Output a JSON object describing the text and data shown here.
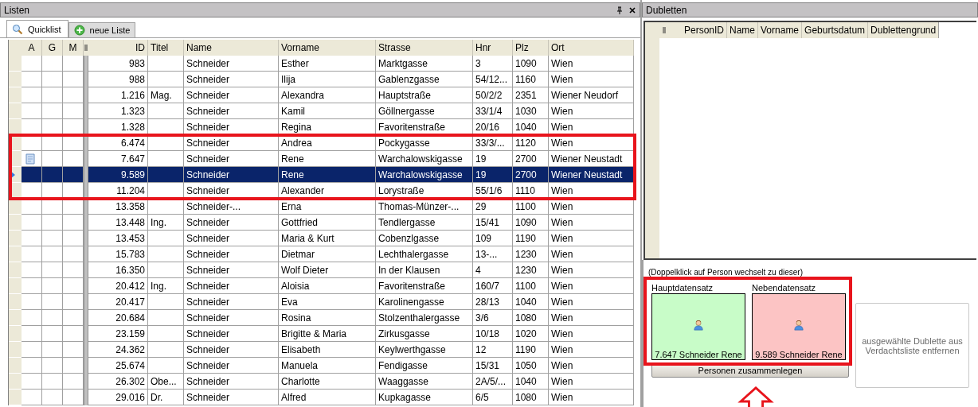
{
  "left_panel": {
    "title": "Listen",
    "tabs": [
      {
        "label": "Quicklist",
        "selected": true
      },
      {
        "label": "neue Liste",
        "selected": false
      }
    ],
    "table": {
      "columns": [
        "A",
        "G",
        "M",
        "ID",
        "Titel",
        "Name",
        "Vorname",
        "Strasse",
        "Hnr",
        "Plz",
        "Ort"
      ],
      "rows": [
        {
          "id": "983",
          "name": "Schneider",
          "vorname": "Esther",
          "strasse": "Marktgasse",
          "hnr": "3",
          "plz": "1090",
          "ort": "Wien",
          "note": false,
          "selected": false
        },
        {
          "id": "988",
          "name": "Schneider",
          "vorname": "Ilija",
          "strasse": "Gablenzgasse",
          "hnr": "54/12...",
          "plz": "1160",
          "ort": "Wien",
          "note": false,
          "selected": false
        },
        {
          "id": "1.216",
          "titel": "Mag.",
          "name": "Schneider",
          "vorname": "Alexandra",
          "strasse": "Hauptstraße",
          "hnr": "50/2/2",
          "plz": "2351",
          "ort": "Wiener Neudorf",
          "note": false,
          "selected": false
        },
        {
          "id": "1.323",
          "name": "Schneider",
          "vorname": "Kamil",
          "strasse": "Göllnergasse",
          "hnr": "33/1/4",
          "plz": "1030",
          "ort": "Wien",
          "note": false,
          "selected": false
        },
        {
          "id": "1.328",
          "name": "Schneider",
          "vorname": "Regina",
          "strasse": "Favoritenstraße",
          "hnr": "20/16",
          "plz": "1040",
          "ort": "Wien",
          "note": false,
          "selected": false
        },
        {
          "id": "6.474",
          "name": "Schneider",
          "vorname": "Andrea",
          "strasse": "Pockygasse",
          "hnr": "33/3/...",
          "plz": "1120",
          "ort": "Wien",
          "note": false,
          "selected": false
        },
        {
          "id": "7.647",
          "name": "Schneider",
          "vorname": "Rene",
          "strasse": "Warchalowskigasse",
          "hnr": "19",
          "plz": "2700",
          "ort": "Wiener Neustadt",
          "note": true,
          "selected": false
        },
        {
          "id": "9.589",
          "name": "Schneider",
          "vorname": "Rene",
          "strasse": "Warchalowskigasse",
          "hnr": "19",
          "plz": "2700",
          "ort": "Wiener Neustadt",
          "note": false,
          "selected": true
        },
        {
          "id": "11.204",
          "name": "Schneider",
          "vorname": "Alexander",
          "strasse": "Lorystraße",
          "hnr": "55/1/6",
          "plz": "1110",
          "ort": "Wien",
          "note": false,
          "selected": false
        },
        {
          "id": "13.358",
          "name": "Schneider-...",
          "vorname": "Erna",
          "strasse": "Thomas-Münzer-...",
          "hnr": "29",
          "plz": "1100",
          "ort": "Wien",
          "note": false,
          "selected": false
        },
        {
          "id": "13.448",
          "titel": "Ing.",
          "name": "Schneider",
          "vorname": "Gottfried",
          "strasse": "Tendlergasse",
          "hnr": "15/41",
          "plz": "1090",
          "ort": "Wien",
          "note": false,
          "selected": false
        },
        {
          "id": "13.453",
          "name": "Schneider",
          "vorname": "Maria & Kurt",
          "strasse": "Cobenzlgasse",
          "hnr": "109",
          "plz": "1190",
          "ort": "Wien",
          "note": false,
          "selected": false
        },
        {
          "id": "15.783",
          "name": "Schneider",
          "vorname": "Dietmar",
          "strasse": "Lechthalergasse",
          "hnr": "13-...",
          "plz": "1230",
          "ort": "Wien",
          "note": false,
          "selected": false
        },
        {
          "id": "16.350",
          "name": "Schneider",
          "vorname": "Wolf Dieter",
          "strasse": "In der Klausen",
          "hnr": "4",
          "plz": "1230",
          "ort": "Wien",
          "note": false,
          "selected": false
        },
        {
          "id": "20.412",
          "titel": "Ing.",
          "name": "Schneider",
          "vorname": "Aloisia",
          "strasse": "Favoritenstraße",
          "hnr": "160/7",
          "plz": "1100",
          "ort": "Wien",
          "note": false,
          "selected": false
        },
        {
          "id": "20.417",
          "name": "Schneider",
          "vorname": "Eva",
          "strasse": "Karolinengasse",
          "hnr": "28/13",
          "plz": "1040",
          "ort": "Wien",
          "note": false,
          "selected": false
        },
        {
          "id": "20.684",
          "name": "Schneider",
          "vorname": "Rosina",
          "strasse": "Stolzenthalergasse",
          "hnr": "3/6",
          "plz": "1080",
          "ort": "Wien",
          "note": false,
          "selected": false
        },
        {
          "id": "23.159",
          "name": "Schneider",
          "vorname": "Brigitte & Maria",
          "strasse": "Zirkusgasse",
          "hnr": "10/18",
          "plz": "1020",
          "ort": "Wien",
          "note": false,
          "selected": false
        },
        {
          "id": "24.362",
          "name": "Schneider",
          "vorname": "Elisabeth",
          "strasse": "Keylwerthgasse",
          "hnr": "12",
          "plz": "1190",
          "ort": "Wien",
          "note": false,
          "selected": false
        },
        {
          "id": "25.674",
          "name": "Schneider",
          "vorname": "Manuela",
          "strasse": "Fendigasse",
          "hnr": "15/31",
          "plz": "1050",
          "ort": "Wien",
          "note": false,
          "selected": false
        },
        {
          "id": "26.302",
          "titel": "Obe...",
          "name": "Schneider",
          "vorname": "Charlotte",
          "strasse": "Waaggasse",
          "hnr": "2A/5/...",
          "plz": "1040",
          "ort": "Wien",
          "note": false,
          "selected": false
        },
        {
          "id": "29.016",
          "titel": "Dr.",
          "name": "Schneider",
          "vorname": "Alfred",
          "strasse": "Kupkagasse",
          "hnr": "6/5",
          "plz": "1080",
          "ort": "Wien",
          "note": false,
          "selected": false
        }
      ]
    }
  },
  "right_panel": {
    "title": "Dubletten",
    "columns": [
      "PersonID",
      "Name",
      "Vorname",
      "Geburtsdatum",
      "Dublettengrund"
    ],
    "hint": "(Doppelklick auf Person wechselt zu dieser)",
    "records": [
      {
        "kind": "main",
        "label": "Hauptdatensatz",
        "caption": "7.647 Schneider Rene"
      },
      {
        "kind": "secondary",
        "label": "Nebendatensatz",
        "caption": "9.589 Schneider Rene"
      }
    ],
    "merge_button": "Personen zusammenlegen",
    "remove_button": "ausgewählte Dublette aus Verdachtsliste entfernen"
  }
}
